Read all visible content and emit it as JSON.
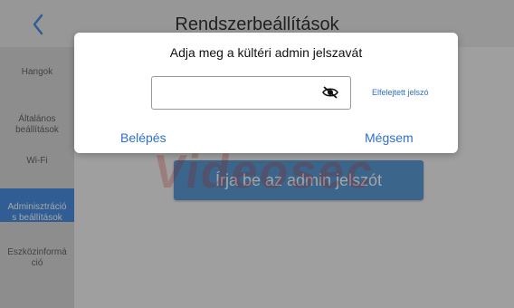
{
  "header": {
    "title": "Rendszerbeállítások",
    "back_icon": "chevron-left-icon"
  },
  "sidebar": {
    "items": [
      {
        "label": "Hangok"
      },
      {
        "label": "Általános\nbeállítások"
      },
      {
        "label": "Wi-Fi"
      },
      {
        "label": "Adminisztráció\ns beállítások",
        "active": true
      },
      {
        "label": "Eszközinformá\nció"
      }
    ]
  },
  "main": {
    "big_button_label": "Írja be az admin jelszót"
  },
  "watermark": {
    "text": "Videosec"
  },
  "dialog": {
    "title": "Adja meg a kültéri admin jelszavát",
    "password_value": "",
    "eye_icon": "eye-off-icon",
    "forgot_label": "Elfelejtett jelszó",
    "enter_label": "Belépés",
    "cancel_label": "Mégsem"
  },
  "colors": {
    "accent": "#4a90e2",
    "link": "#2f6fd0",
    "watermark": "#dc2828"
  }
}
